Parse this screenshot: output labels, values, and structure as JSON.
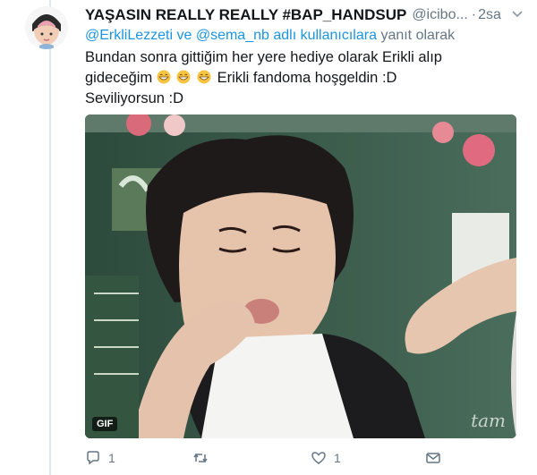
{
  "tweet": {
    "display_name": "YAŞASIN REALLY REALLY #BAP_HANDSUP",
    "handle": "@icibo...",
    "separator": "·",
    "time": "2sa",
    "reply_prefix_mentions": "@ErkliLezzeti ve @sema_nb",
    "reply_suffix_tail": "adlı kullanıcılara",
    "reply_suffix": "yanıt olarak",
    "text_line1": "Bundan sonra gittiğim her yere hediye olarak Erikli alıp",
    "text_line2_start": "gideceğim",
    "text_line2_end": "Erikli fandoma hoşgeldin :D",
    "text_line3": "Seviliyorsun :D",
    "media_badge": "GIF",
    "media_watermark": "tam",
    "reply_count": "1",
    "retweet_count": "",
    "like_count": "1"
  },
  "icons": {
    "avatar": "profile-avatar",
    "more": "chevron-down-icon",
    "reply": "reply-icon",
    "retweet": "retweet-icon",
    "like": "heart-icon",
    "dm": "envelope-icon",
    "emoji": "grinning-tears-emoji"
  },
  "colors": {
    "link": "#1b95e0",
    "secondary": "#657786",
    "emoji_yellow": "#f5c542"
  }
}
